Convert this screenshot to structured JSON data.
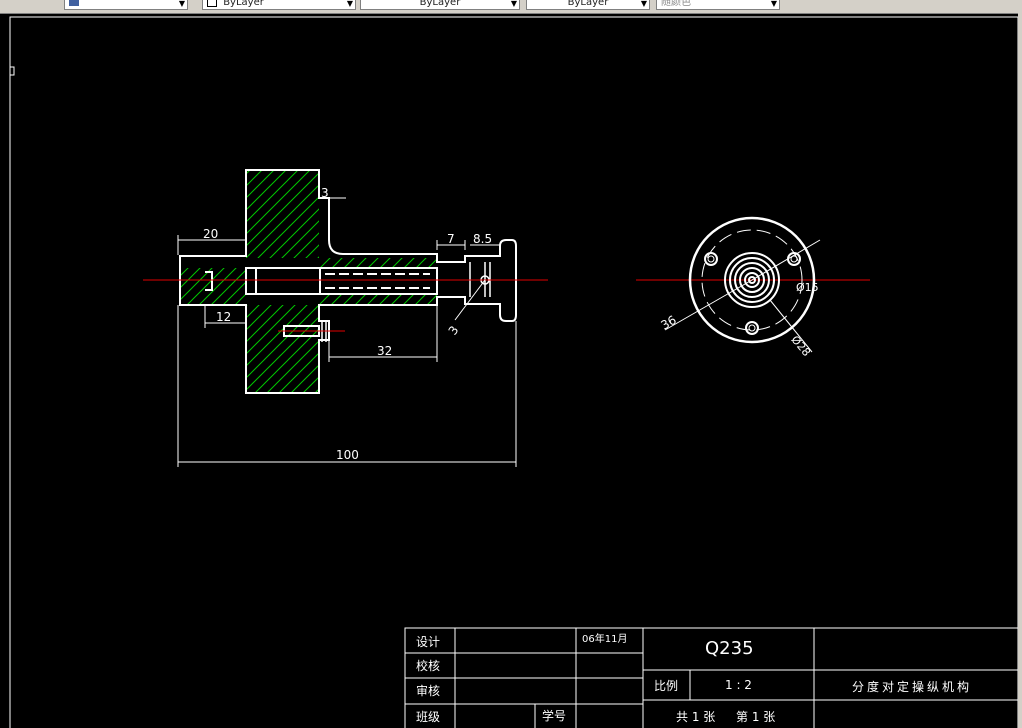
{
  "toolbar": {
    "field1": "",
    "field2": "ByLayer",
    "field3": "ByLayer",
    "field4": "ByLayer",
    "field5": "随颜色"
  },
  "dimensions": {
    "d_3_top": "3",
    "d_20": "20",
    "d_7": "7",
    "d_8_5": "8.5",
    "d_12": "12",
    "d_3_slant": "3",
    "d_32": "32",
    "d_100": "100",
    "d_36": "36",
    "d_15": "Ø15",
    "d_28": "Ø28"
  },
  "title_block": {
    "design_label": "设计",
    "check_label": "校核",
    "review_label": "审核",
    "class_label": "班级",
    "student_id_label": "学号",
    "date": "06年11月",
    "material": "Q235",
    "scale_label": "比例",
    "scale_value": "1 : 2",
    "part_name": "分度对定操纵机构",
    "sheet_total": "共 1 张",
    "sheet_number": "第 1 张"
  },
  "colors": {
    "background": "#000000",
    "outline": "#ffffff",
    "hatch": "#00c800",
    "centerline": "#e00000",
    "toolbar": "#d4d0c8"
  }
}
